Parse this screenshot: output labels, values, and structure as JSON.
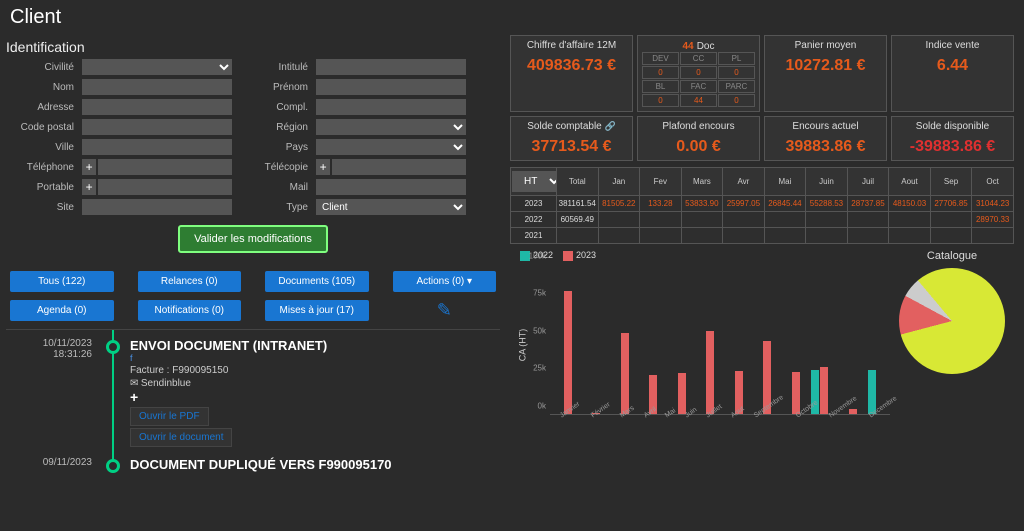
{
  "header": {
    "title": "Client"
  },
  "identification": {
    "section_title": "Identification",
    "labels": {
      "civilite": "Civilité",
      "intitule": "Intitulé",
      "nom": "Nom",
      "prenom": "Prénom",
      "adresse": "Adresse",
      "compl": "Compl.",
      "codepostal": "Code postal",
      "region": "Région",
      "ville": "Ville",
      "pays": "Pays",
      "telephone": "Téléphone",
      "telecopie": "Télécopie",
      "portable": "Portable",
      "mail": "Mail",
      "site": "Site",
      "type": "Type"
    },
    "values": {
      "type": "Client"
    },
    "validate": "Valider les modifications"
  },
  "filters": {
    "tous": "Tous  (122)",
    "relances": "Relances  (0)",
    "documents": "Documents  (105)",
    "actions": "Actions  (0) ▾",
    "agenda": "Agenda  (0)",
    "notifications": "Notifications  (0)",
    "maj": "Mises à jour  (17)"
  },
  "timeline": [
    {
      "date": "10/11/2023",
      "time": "18:31:26",
      "title": "ENVOI DOCUMENT (INTRANET)",
      "sub": "Facture : F990095150",
      "sender": "Sendinblue",
      "open_pdf": "Ouvrir le PDF",
      "open_doc": "Ouvrir le document",
      "show_buttons": true
    },
    {
      "date": "09/11/2023",
      "time": "",
      "title": "DOCUMENT DUPLIQUÉ VERS F990095170",
      "sub": "",
      "sender": "",
      "show_buttons": false
    }
  ],
  "kpis": {
    "ca12m": {
      "label": "Chiffre d'affaire 12M",
      "value": "409836.73 €"
    },
    "docs": {
      "count": "44",
      "label": "Doc",
      "grid": [
        [
          "DEV",
          "CC",
          "PL"
        ],
        [
          "0",
          "0",
          "0"
        ],
        [
          "BL",
          "FAC",
          "PARC"
        ],
        [
          "0",
          "44",
          "0"
        ]
      ]
    },
    "panier": {
      "label": "Panier moyen",
      "value": "10272.81 €"
    },
    "indice": {
      "label": "Indice vente",
      "value": "6.44"
    },
    "solde": {
      "label": "Solde comptable ",
      "value": "37713.54 €"
    },
    "plafond": {
      "label": "Plafond encours",
      "value": "0.00 €"
    },
    "encours": {
      "label": "Encours actuel",
      "value": "39883.86 €"
    },
    "dispo": {
      "label": "Solde disponible",
      "value": "-39883.86 €"
    }
  },
  "sales": {
    "dropdown": "HT",
    "headers": [
      "",
      "Total",
      "Jan",
      "Fev",
      "Mars",
      "Avr",
      "Mai",
      "Juin",
      "Juil",
      "Aout",
      "Sep",
      "Oct"
    ],
    "rows": [
      {
        "year": "2023",
        "total": "381161.54",
        "cells": [
          "81505.22",
          "133.28",
          "53833.90",
          "25997.05",
          "26845.44",
          "55288.53",
          "28737.85",
          "48150.03",
          "27706.85",
          "31044.23"
        ]
      },
      {
        "year": "2022",
        "total": "60569.49",
        "cells": [
          "",
          "",
          "",
          "",
          "",
          "",
          "",
          "",
          "",
          "28970.33"
        ]
      },
      {
        "year": "2021",
        "total": "",
        "cells": [
          "",
          "",
          "",
          "",
          "",
          "",
          "",
          "",
          "",
          ""
        ]
      }
    ]
  },
  "chart_data": {
    "type": "bar",
    "title": "",
    "ylabel": "CA (HT)",
    "ylim": [
      0,
      100000
    ],
    "yticks": [
      "0k",
      "25k",
      "50k",
      "75k",
      "100k"
    ],
    "categories": [
      "Janvier",
      "Février",
      "Mars",
      "Avril",
      "Mai",
      "Juin",
      "Juillet",
      "Aout",
      "Septembre",
      "Octobre",
      "Novembre",
      "Decembre"
    ],
    "series": [
      {
        "name": "2022",
        "color": "#1fb8a6",
        "values": [
          0,
          0,
          0,
          0,
          0,
          0,
          0,
          0,
          0,
          29000,
          0,
          29000
        ]
      },
      {
        "name": "2023",
        "color": "#e26060",
        "values": [
          81500,
          133,
          53800,
          26000,
          26800,
          55300,
          28700,
          48200,
          27700,
          31000,
          3000,
          0
        ]
      }
    ]
  },
  "pie": {
    "title": "Catalogue",
    "slices": [
      {
        "color": "#d8e835",
        "pct": 82
      },
      {
        "color": "#e26060",
        "pct": 12
      },
      {
        "color": "#cccccc",
        "pct": 6
      }
    ]
  }
}
